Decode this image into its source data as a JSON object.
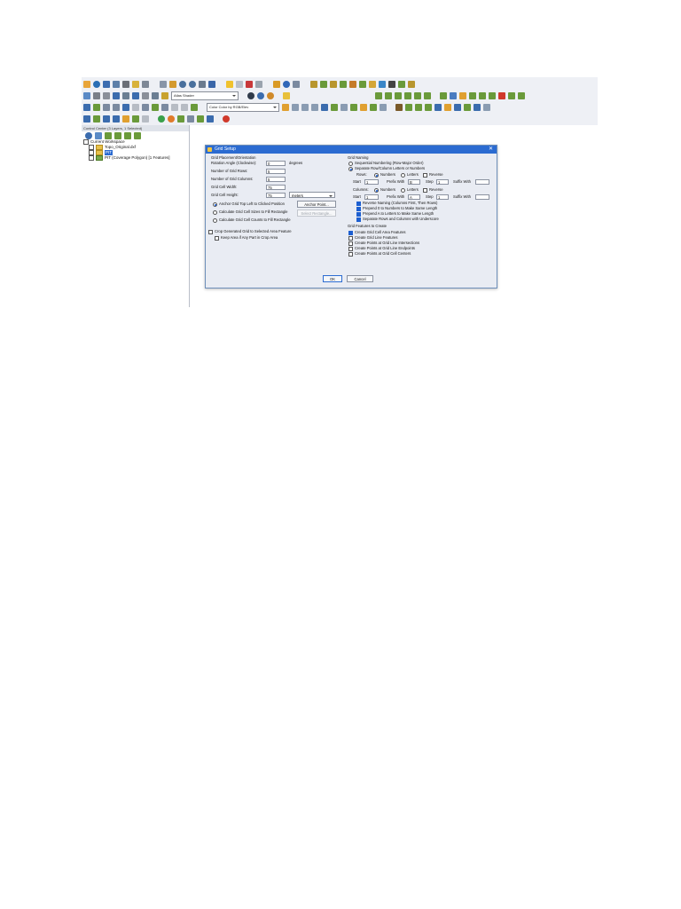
{
  "toolbar": {
    "shader_combo": "Atlas Shader",
    "color_combo": "Color Color by RGB/Elev"
  },
  "control_center": {
    "title": "Control Center (3 Layers, 1 Selected)",
    "workspace": "Current Workspace",
    "layers": [
      {
        "label": "Topo_Original.dxf"
      },
      {
        "label": "PIT"
      },
      {
        "label": "PIT (Coverage Polygon) [1 Features]"
      }
    ]
  },
  "dialog": {
    "title": "Grid Setup",
    "placement": {
      "header": "Grid Placement/Orientation",
      "rotation_label": "Rotation Angle (Clockwise):",
      "rotation_value": "0",
      "rotation_unit": "degrees",
      "rows_label": "Number of Grid Rows:",
      "rows_value": "5",
      "cols_label": "Number of Grid Columns:",
      "cols_value": "5",
      "width_label": "Grid Cell Width:",
      "width_value": "75",
      "height_label": "Grid Cell Height:",
      "height_value": "75",
      "units_value": "meters",
      "anchor_option": "Anchor Grid Top Left to Clicked Position",
      "anchor_button": "Anchor Point...",
      "calc_sizes_option": "Calculate Grid Cell Sizes to Fill Rectangle",
      "select_rect_button": "Select Rectangle...",
      "calc_counts_option": "Calculate Grid Cell Counts to Fill Rectangle",
      "crop_option": "Crop Generated Grid to Selected Area Feature",
      "keep_option": "Keep Area if Any Part in Crop Area"
    },
    "naming": {
      "header": "Grid Naming",
      "sequential_option": "Sequential Numbering (Row-Major Order)",
      "separate_option": "Separate Row/Column Letters or Numbers",
      "rows_label": "Rows:",
      "cols_label": "Columns:",
      "numbers": "Numbers",
      "letters": "Letters",
      "reverse": "Reverse",
      "start_label": "Start",
      "rows_start": "1",
      "prefix_label": "Prefix With",
      "rows_prefix": "B",
      "step_label": "Step",
      "rows_step": "1",
      "suffix_label": "Suffix With",
      "cols_start": "1",
      "cols_prefix": "A",
      "cols_step": "1",
      "reverse_naming": "Reverse Naming (Columns First, Then Rows)",
      "prepend_zero": "Prepend 0 to Numbers to Make Same Length",
      "prepend_a": "Prepend A to Letters to Make Same Length",
      "separate_underscore": "Separate Rows and Columns with Underscore"
    },
    "features": {
      "header": "Grid Features to Create",
      "items": [
        {
          "label": "Create Grid Cell Area Features",
          "checked": true
        },
        {
          "label": "Create Grid Line Features",
          "checked": false
        },
        {
          "label": "Create Points at Grid Line Intersections",
          "checked": false
        },
        {
          "label": "Create Points at Grid Line Endpoints",
          "checked": false
        },
        {
          "label": "Create Points at Grid Cell Centers",
          "checked": false
        }
      ]
    },
    "ok": "OK",
    "cancel": "Cancel"
  }
}
